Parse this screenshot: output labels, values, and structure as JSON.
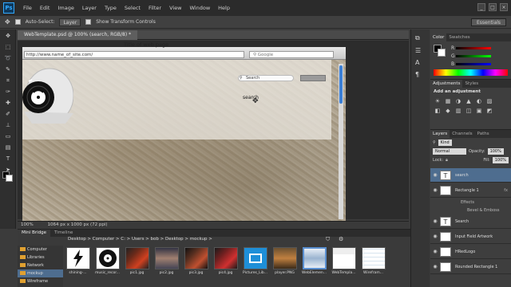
{
  "menubar": {
    "logo": "Ps",
    "items": [
      "File",
      "Edit",
      "Image",
      "Layer",
      "Type",
      "Select",
      "Filter",
      "View",
      "Window",
      "Help"
    ]
  },
  "options": {
    "auto_select": "Auto-Select:",
    "auto_select_target": "Layer",
    "show_transform": "Show Transform Controls",
    "workspace": "Essentials"
  },
  "document": {
    "tab_title": "WebTemplate.psd @ 100% (search, RGB/8) *",
    "status": "100%",
    "doc_size": "1064 px x 1000 px (72 ppi)"
  },
  "mockup": {
    "page_title": "Title of web page",
    "address": "http://www.name_of_site.com/",
    "google_placeholder": "Google",
    "search_placeholder": "Search",
    "search_text": "search"
  },
  "color_panel": {
    "tabs": [
      "Color",
      "Swatches"
    ],
    "channels": [
      "R",
      "G",
      "B"
    ]
  },
  "adjustments": {
    "tabs": [
      "Adjustments",
      "Styles"
    ],
    "header": "Add an adjustment",
    "icons": [
      "☀",
      "▦",
      "◑",
      "▲",
      "◐",
      "▨",
      "◧",
      "◆",
      "▥",
      "◫",
      "▣",
      "◩"
    ]
  },
  "layers": {
    "tabs": [
      "Layers",
      "Channels",
      "Paths"
    ],
    "kind": "Kind",
    "blend_mode": "Normal",
    "opacity_label": "Opacity:",
    "opacity": "100%",
    "lock_label": "Lock:",
    "fill_label": "Fill:",
    "fill": "100%",
    "items": [
      {
        "name": "search",
        "thumb": "T",
        "selected": true
      },
      {
        "name": "Rectangle 1",
        "thumb": "",
        "fx": "fx"
      },
      {
        "name": "Search",
        "thumb": "T"
      },
      {
        "name": "Input Field Artwork",
        "thumb": ""
      },
      {
        "name": "HRedLogo",
        "thumb": ""
      },
      {
        "name": "Rounded Rectangle 1",
        "thumb": ""
      }
    ],
    "effects_label": "Effects",
    "bevel_label": "Bevel & Emboss"
  },
  "bridge": {
    "tabs": [
      "Mini Bridge",
      "Timeline"
    ],
    "crumbs": "Desktop  >  Computer  >  C:  >  Users  >  bob  >  Desktop  >  mockup  >",
    "side_root": "Computer",
    "side_items": [
      "Libraries",
      "Network",
      "mockup",
      "Wireframe"
    ],
    "thumbs": [
      "shining-...",
      "music_recor...",
      "pic1.jpg",
      "pic2.jpg",
      "pic3.jpg",
      "pic4.jpg",
      "Pictures_Lib...",
      "player.PNG",
      "WebElemen...",
      "WebTempla...",
      "Wirefram..."
    ]
  }
}
